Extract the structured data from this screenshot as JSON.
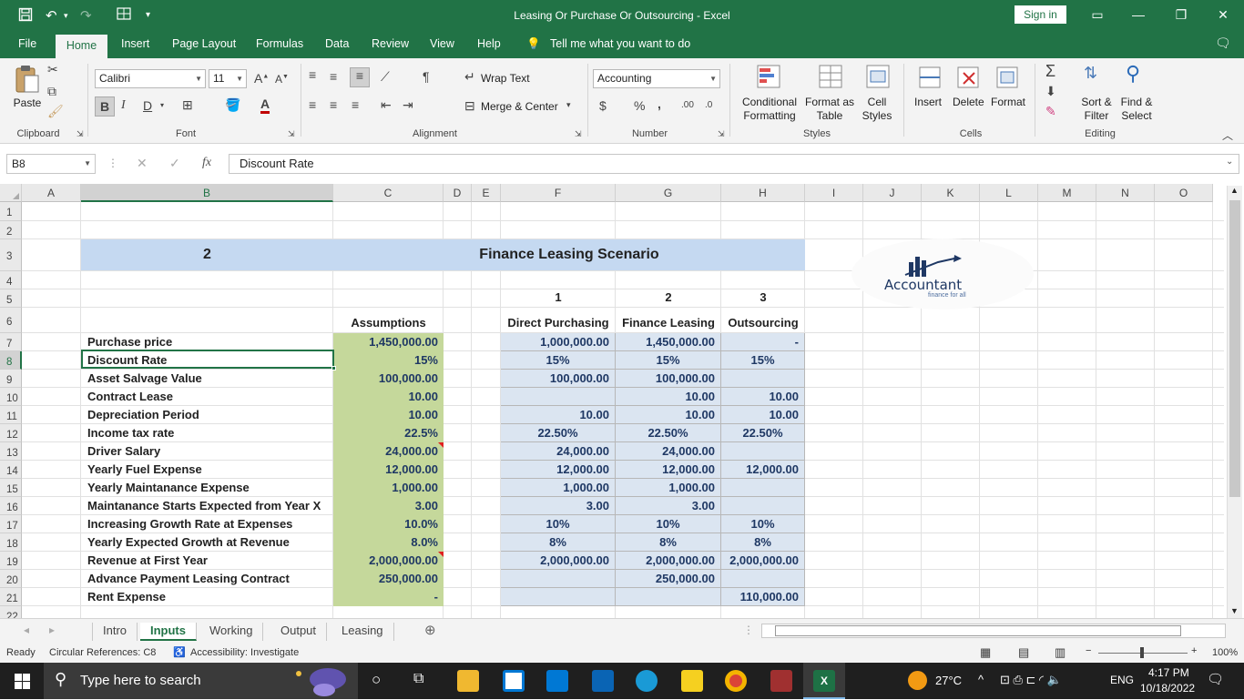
{
  "window": {
    "title": "Leasing Or Purchase Or Outsourcing  -  Excel",
    "sign_in": "Sign in"
  },
  "menu": {
    "tabs": [
      "File",
      "Home",
      "Insert",
      "Page Layout",
      "Formulas",
      "Data",
      "Review",
      "View",
      "Help"
    ],
    "tell_me": "Tell me what you want to do"
  },
  "ribbon": {
    "clipboard": {
      "paste": "Paste",
      "label": "Clipboard"
    },
    "font": {
      "name": "Calibri",
      "size": "11",
      "label": "Font"
    },
    "alignment": {
      "wrap_text": "Wrap Text",
      "merge_center": "Merge & Center",
      "label": "Alignment"
    },
    "number": {
      "format": "Accounting",
      "label": "Number"
    },
    "styles": {
      "conditional": "Conditional",
      "formatting": "Formatting",
      "format_as": "Format as",
      "table": "Table",
      "cell": "Cell",
      "styles": "Styles",
      "label": "Styles"
    },
    "cells": {
      "insert": "Insert",
      "delete": "Delete",
      "format": "Format",
      "label": "Cells"
    },
    "editing": {
      "sort": "Sort &",
      "filter": "Filter",
      "find": "Find &",
      "select": "Select",
      "label": "Editing"
    }
  },
  "formula_bar": {
    "name_box": "B8",
    "content": "Discount Rate"
  },
  "columns": [
    "A",
    "B",
    "C",
    "D",
    "E",
    "F",
    "G",
    "H",
    "I",
    "J",
    "K",
    "L",
    "M",
    "N",
    "O"
  ],
  "rows": [
    "1",
    "2",
    "3",
    "4",
    "5",
    "6",
    "7",
    "8",
    "9",
    "10",
    "11",
    "12",
    "13",
    "14",
    "15",
    "16",
    "17",
    "18",
    "19",
    "20",
    "21",
    "22"
  ],
  "sheet": {
    "section_number": "2",
    "section_title": "Finance Leasing Scenario",
    "logo_text": "Accountant",
    "logo_sub": "finance for all",
    "col_numbers": [
      "1",
      "2",
      "3"
    ],
    "headers": {
      "assumptions": "Assumptions",
      "direct": "Direct Purchasing",
      "leasing": "Finance Leasing",
      "outsourcing": "Outsourcing"
    },
    "rows": [
      {
        "label": "Purchase price",
        "c": "1,450,000.00",
        "f": "1,000,000.00",
        "g": "1,450,000.00",
        "h": "-"
      },
      {
        "label": "Discount Rate",
        "c": "15%",
        "f": "15%",
        "g": "15%",
        "h": "15%"
      },
      {
        "label": "Asset Salvage Value",
        "c": "100,000.00",
        "f": "100,000.00",
        "g": "100,000.00",
        "h": ""
      },
      {
        "label": "Contract Lease",
        "c": "10.00",
        "f": "",
        "g": "10.00",
        "h": "10.00"
      },
      {
        "label": "Depreciation Period",
        "c": "10.00",
        "f": "10.00",
        "g": "10.00",
        "h": "10.00"
      },
      {
        "label": "Income tax rate",
        "c": "22.5%",
        "f": "22.50%",
        "g": "22.50%",
        "h": "22.50%"
      },
      {
        "label": "Driver Salary",
        "c": "24,000.00",
        "f": "24,000.00",
        "g": "24,000.00",
        "h": ""
      },
      {
        "label": "Yearly Fuel Expense",
        "c": "12,000.00",
        "f": "12,000.00",
        "g": "12,000.00",
        "h": "12,000.00"
      },
      {
        "label": "Yearly Maintanance Expense",
        "c": "1,000.00",
        "f": "1,000.00",
        "g": "1,000.00",
        "h": ""
      },
      {
        "label": "Maintanance Starts Expected from Year X",
        "c": "3.00",
        "f": "3.00",
        "g": "3.00",
        "h": ""
      },
      {
        "label": "Increasing Growth Rate at Expenses",
        "c": "10.0%",
        "f": "10%",
        "g": "10%",
        "h": "10%"
      },
      {
        "label": "Yearly Expected Growth at Revenue",
        "c": "8.0%",
        "f": "8%",
        "g": "8%",
        "h": "8%"
      },
      {
        "label": "Revenue at First Year",
        "c": "2,000,000.00",
        "f": "2,000,000.00",
        "g": "2,000,000.00",
        "h": "2,000,000.00"
      },
      {
        "label": "Advance Payment Leasing Contract",
        "c": "250,000.00",
        "f": "",
        "g": "250,000.00",
        "h": ""
      },
      {
        "label": "Rent Expense",
        "c": "-",
        "f": "",
        "g": "",
        "h": "110,000.00"
      }
    ]
  },
  "sheet_tabs": [
    "Intro",
    "Inputs",
    "Working",
    "Output",
    "Leasing"
  ],
  "active_sheet": "Inputs",
  "status": {
    "ready": "Ready",
    "circular": "Circular References: C8",
    "accessibility": "Accessibility: Investigate",
    "zoom": "100%"
  },
  "taskbar": {
    "search_placeholder": "Type here to search",
    "temperature": "27°C",
    "language": "ENG",
    "time": "4:17 PM",
    "date": "10/18/2022"
  },
  "colors": {
    "excel_green": "#217346",
    "assumption_fill": "#c5d89b",
    "scenario_fill": "#dbe5f1",
    "title_fill": "#c5d9f1",
    "value_text": "#1f3864"
  }
}
